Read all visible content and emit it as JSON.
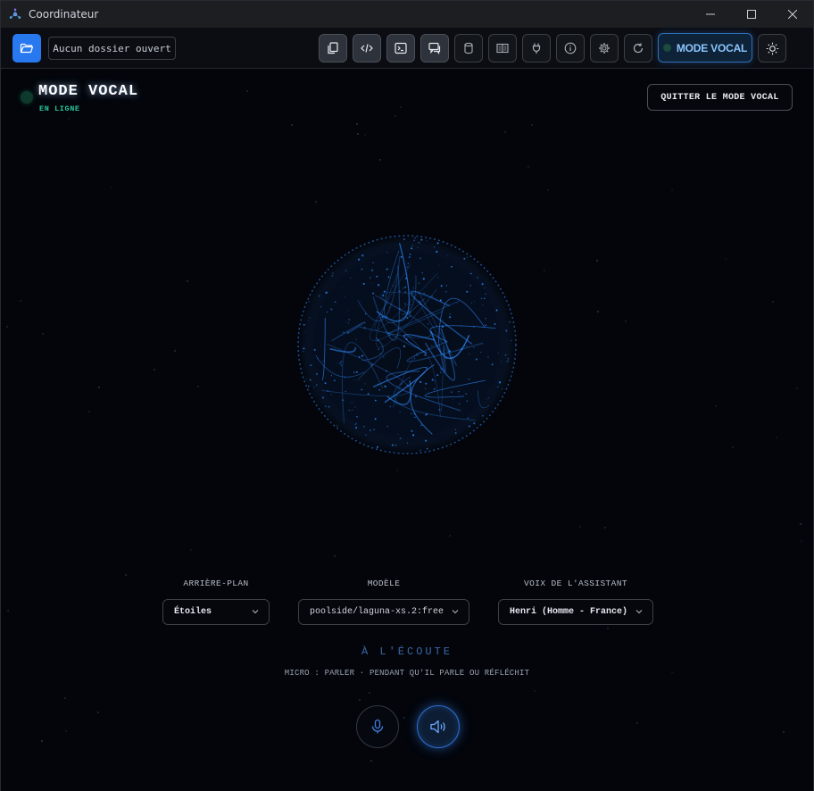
{
  "window": {
    "title": "Coordinateur"
  },
  "toolbar": {
    "folder_field": "Aucun dossier ouvert",
    "mode_vocal_label": "MODE VOCAL",
    "buttons": [
      {
        "name": "copy-icon",
        "active": true
      },
      {
        "name": "code-icon",
        "active": true
      },
      {
        "name": "terminal-icon",
        "active": true
      },
      {
        "name": "chat-icon",
        "active": true
      },
      {
        "name": "database-icon",
        "active": false
      },
      {
        "name": "book-icon",
        "active": false
      },
      {
        "name": "plug-icon",
        "active": false
      },
      {
        "name": "info-icon",
        "active": false
      },
      {
        "name": "gear-icon",
        "active": false
      },
      {
        "name": "refresh-icon",
        "active": false
      }
    ]
  },
  "voice": {
    "title": "MODE VOCAL",
    "status": "EN LIGNE",
    "quit_label": "QUITTER LE MODE VOCAL",
    "background": {
      "label": "ARRIÈRE-PLAN",
      "value": "Étoiles"
    },
    "model": {
      "label": "MODÈLE",
      "value": "poolside/laguna-xs.2:free"
    },
    "assistant_voice": {
      "label": "VOIX DE L'ASSISTANT",
      "value": "Henri (Homme - France)"
    },
    "listening": "À L'ÉCOUTE",
    "hint": "MICRO : PARLER · PENDANT QU'IL PARLE OU RÉFLÉCHIT"
  },
  "colors": {
    "accent": "#2878f0",
    "status_online": "#28c79a",
    "orb": "#2f8bff",
    "background": "#03050b"
  }
}
